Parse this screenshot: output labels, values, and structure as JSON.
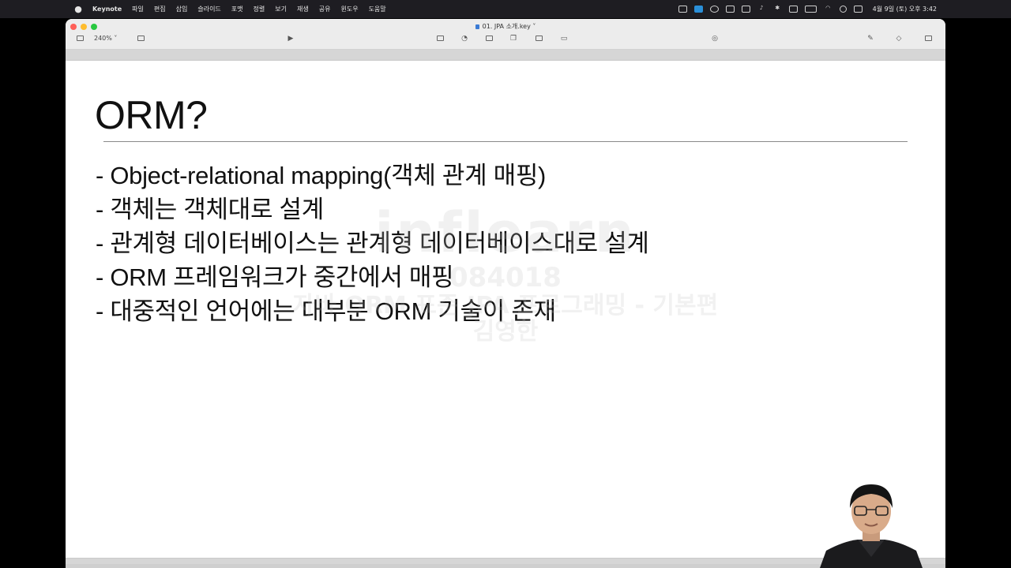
{
  "menubar": {
    "apple": "",
    "app_name": "Keynote",
    "items": [
      "파일",
      "편집",
      "삽입",
      "슬라이드",
      "포맷",
      "정렬",
      "보기",
      "재생",
      "공유",
      "윈도우",
      "도움말"
    ],
    "datetime": "4월 9일 (토) 오후 3:42"
  },
  "window": {
    "document_title": "01. JPA 소개.key",
    "zoom": "240%"
  },
  "slide": {
    "title": "ORM?",
    "bullets": [
      "- Object-relational mapping(객체 관계 매핑)",
      "- 객체는 객체대로 설계",
      "- 관계형 데이터베이스는 관계형 데이터베이스대로 설계",
      "- ORM 프레임워크가 중간에서 매핑",
      "- 대중적인 언어에는 대부분 ORM 기술이 존재"
    ],
    "watermark": {
      "logo": "inflearn",
      "id": "084018",
      "course": "자바 ORM 표준 JPA 프로그래밍 - 기본편",
      "author": "김영한"
    }
  },
  "colors": {
    "menubar_bg": "#1e1d22",
    "slide_bg": "#ffffff",
    "close": "#fe5f57",
    "minimize": "#febc2e",
    "maximize": "#28c840"
  }
}
